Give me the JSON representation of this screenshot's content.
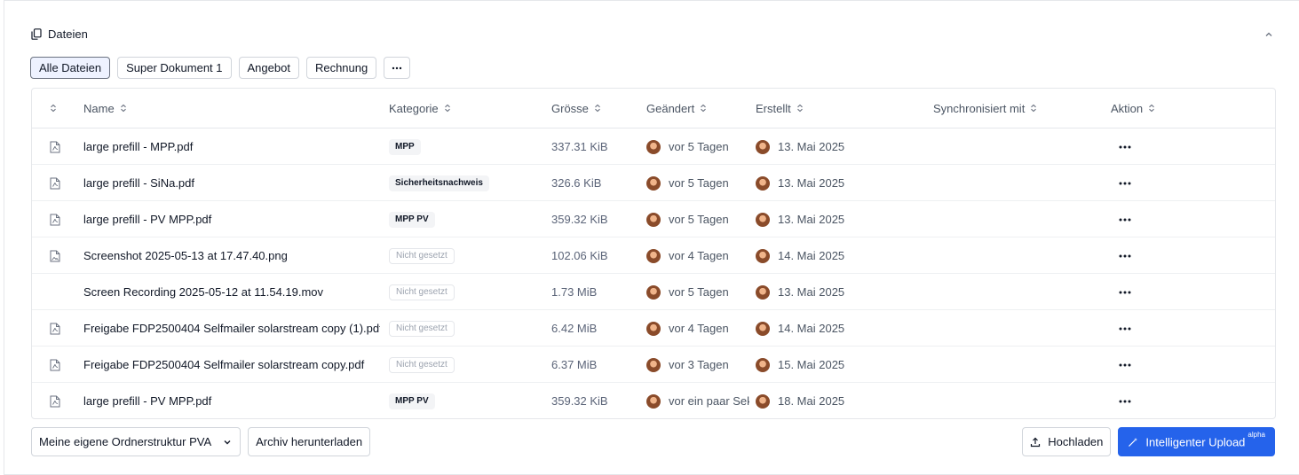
{
  "section": {
    "title": "Dateien"
  },
  "tabs": [
    {
      "label": "Alle Dateien",
      "active": true
    },
    {
      "label": "Super Dokument 1"
    },
    {
      "label": "Angebot"
    },
    {
      "label": "Rechnung"
    }
  ],
  "table": {
    "headers": {
      "name": "Name",
      "category": "Kategorie",
      "size": "Grösse",
      "modified": "Geändert",
      "created": "Erstellt",
      "synced": "Synchronisiert mit",
      "action": "Aktion"
    },
    "rows": [
      {
        "icon": "pdf-file-icon",
        "name": "large prefill - MPP.pdf",
        "category": "MPP",
        "category_unset": false,
        "size": "337.31 KiB",
        "modified": "vor 5 Tagen",
        "created": "13. Mai 2025"
      },
      {
        "icon": "pdf-file-icon",
        "name": "large prefill - SiNa.pdf",
        "category": "Sicherheitsnachweis",
        "category_unset": false,
        "size": "326.6 KiB",
        "modified": "vor 5 Tagen",
        "created": "13. Mai 2025"
      },
      {
        "icon": "pdf-file-icon",
        "name": "large prefill - PV MPP.pdf",
        "category": "MPP PV",
        "category_unset": false,
        "size": "359.32 KiB",
        "modified": "vor 5 Tagen",
        "created": "13. Mai 2025"
      },
      {
        "icon": "image-file-icon",
        "name": "Screenshot 2025-05-13 at 17.47.40.png",
        "category": "Nicht gesetzt",
        "category_unset": true,
        "size": "102.06 KiB",
        "modified": "vor 4 Tagen",
        "created": "14. Mai 2025"
      },
      {
        "icon": "",
        "name": "Screen Recording 2025-05-12 at 11.54.19.mov",
        "category": "Nicht gesetzt",
        "category_unset": true,
        "size": "1.73 MiB",
        "modified": "vor 5 Tagen",
        "created": "13. Mai 2025"
      },
      {
        "icon": "pdf-file-icon",
        "name": "Freigabe FDP2500404 Selfmailer solarstream copy (1).pdf",
        "category": "Nicht gesetzt",
        "category_unset": true,
        "size": "6.42 MiB",
        "modified": "vor 4 Tagen",
        "created": "14. Mai 2025"
      },
      {
        "icon": "pdf-file-icon",
        "name": "Freigabe FDP2500404 Selfmailer solarstream copy.pdf",
        "category": "Nicht gesetzt",
        "category_unset": true,
        "size": "6.37 MiB",
        "modified": "vor 3 Tagen",
        "created": "15. Mai 2025"
      },
      {
        "icon": "pdf-file-icon",
        "name": "large prefill - PV MPP.pdf",
        "category": "MPP PV",
        "category_unset": false,
        "size": "359.32 KiB",
        "modified": "vor ein paar Sekunden",
        "created": "18. Mai 2025"
      }
    ]
  },
  "footer": {
    "folder_select": "Meine eigene Ordnerstruktur PVA",
    "download_archive": "Archiv herunterladen",
    "upload": "Hochladen",
    "smart_upload": "Intelligenter Upload",
    "smart_upload_badge": "alpha"
  },
  "colors": {
    "primary": "#2563eb",
    "active_tab_bg": "#eef2ff"
  }
}
